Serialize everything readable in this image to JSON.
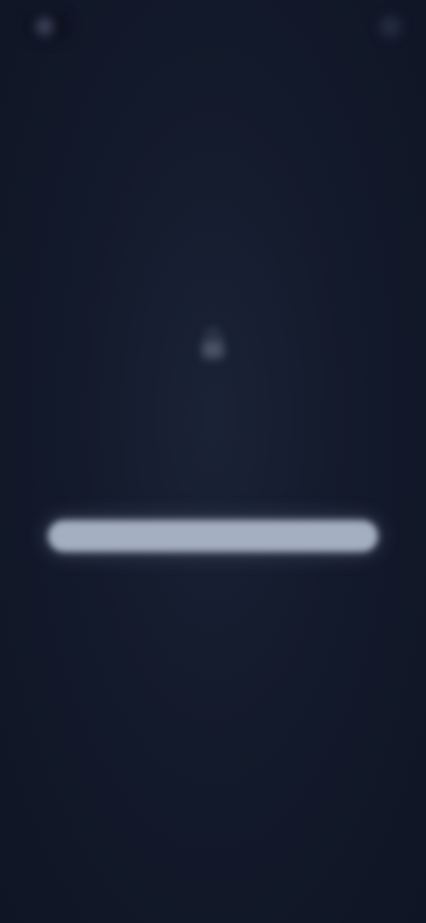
{
  "header": {
    "brand_label": "",
    "action_label": ""
  },
  "content": {
    "icon": "lock-icon",
    "eyebrow": "",
    "headline": "",
    "primary_button_label": "",
    "footnote": ""
  },
  "colors": {
    "background": "#111828",
    "headline": "#cfd5df",
    "button": "#a4afc2"
  }
}
